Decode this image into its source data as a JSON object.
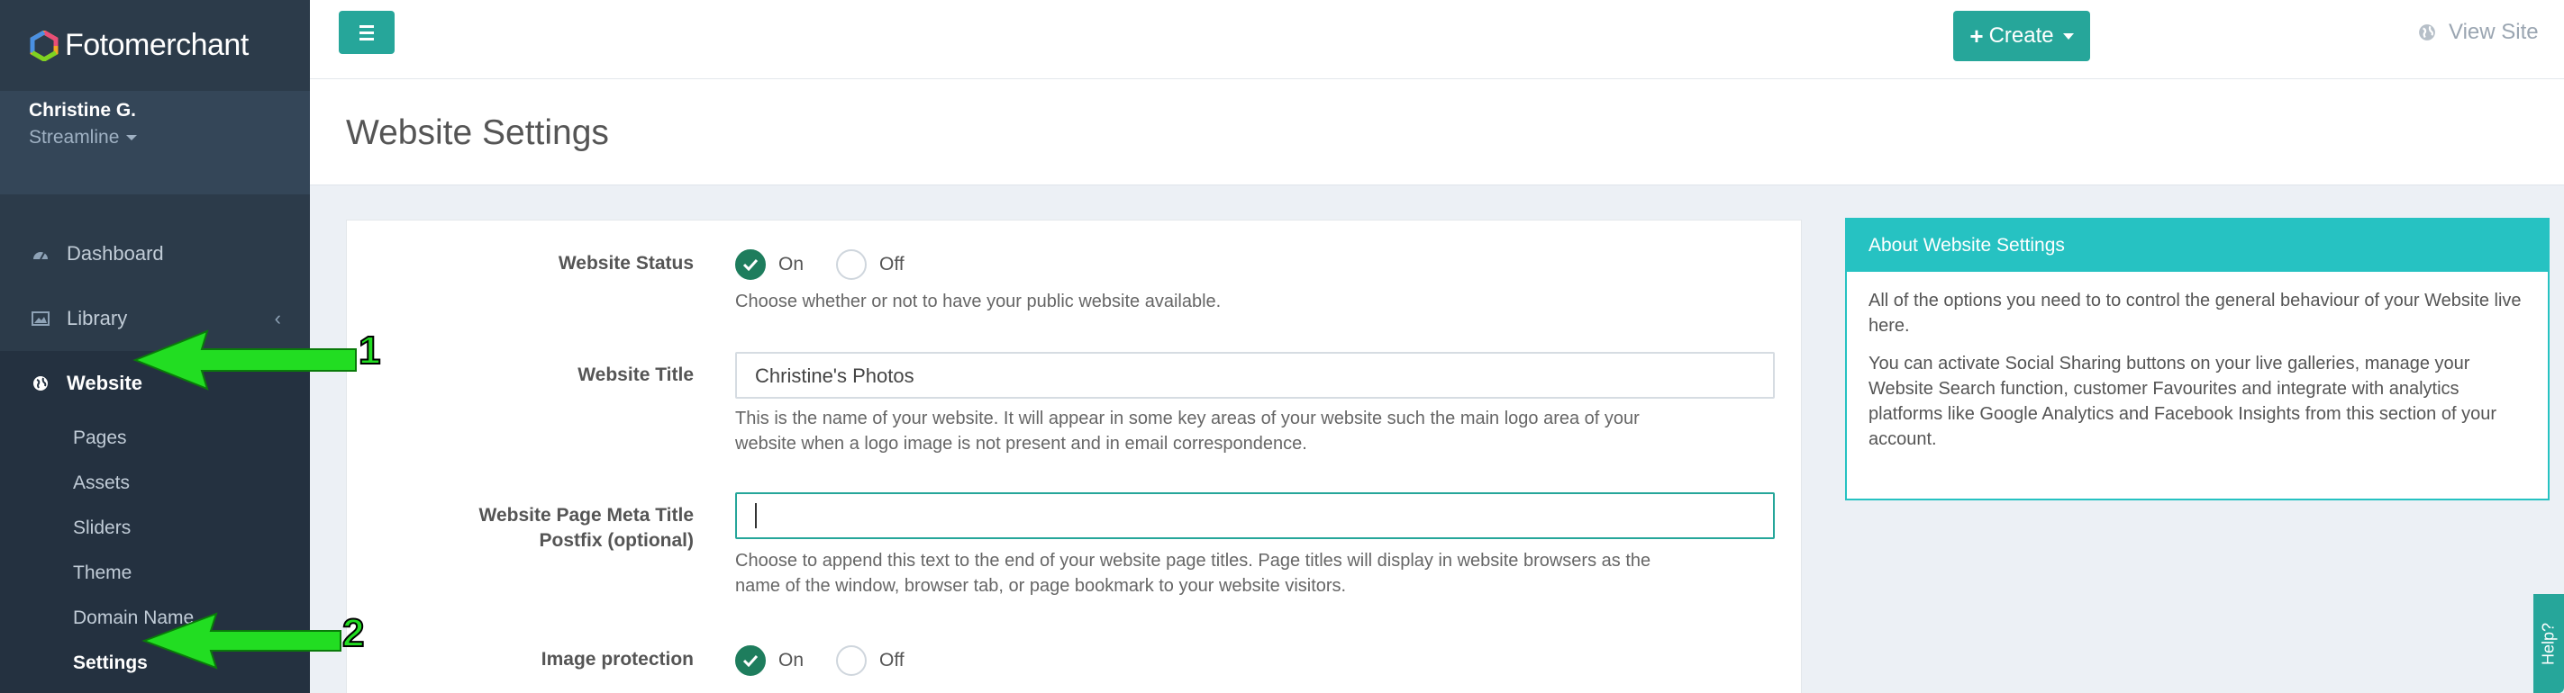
{
  "app": {
    "brand": "Fotomerchant",
    "user_name": "Christine G.",
    "user_plan": "Streamline"
  },
  "sidebar": {
    "items": [
      {
        "label": "Dashboard",
        "icon": "dashboard-icon"
      },
      {
        "label": "Library",
        "icon": "image-icon"
      },
      {
        "label": "Website",
        "icon": "globe-icon"
      }
    ],
    "website_sub": [
      "Pages",
      "Assets",
      "Sliders",
      "Theme",
      "Domain Name",
      "Settings"
    ]
  },
  "topbar": {
    "create_label": "Create",
    "view_site_label": "View Site"
  },
  "page": {
    "title": "Website Settings"
  },
  "form": {
    "website_status": {
      "label": "Website Status",
      "on_label": "On",
      "off_label": "Off",
      "selected": "On",
      "help": "Choose whether or not to have your public website available."
    },
    "website_title": {
      "label": "Website Title",
      "value": "Christine's Photos",
      "help_line1": "This is the name of your website. It will appear in some key areas of your website such the main logo area of your",
      "help_line2": "website when a logo image is not present and in email correspondence."
    },
    "meta_postfix": {
      "label_line1": "Website Page Meta Title",
      "label_line2": "Postfix (optional)",
      "value": "",
      "help_line1": "Choose to append this text to the end of your website page titles. Page titles will display in website browsers as the",
      "help_line2": "name of the window, browser tab, or page bookmark to your website visitors."
    },
    "image_protection": {
      "label": "Image protection",
      "on_label": "On",
      "off_label": "Off",
      "selected": "On"
    }
  },
  "about": {
    "title": "About Website Settings",
    "para1": "All of the options you need to to control the general behaviour of your Website live here.",
    "para2": "You can activate Social Sharing buttons on your live galleries, manage your Website Search function, customer Favourites and integrate with analytics platforms like Google Analytics and Facebook Insights from this section of your account."
  },
  "help_tab": "Help?",
  "annotations": {
    "marker1": "1",
    "marker2": "2"
  },
  "colors": {
    "accent": "#26a69a",
    "sidebar": "#2c3b4a",
    "about_header": "#26c2c2",
    "radio_checked": "#1e7d5d",
    "arrow": "#22dd22"
  }
}
